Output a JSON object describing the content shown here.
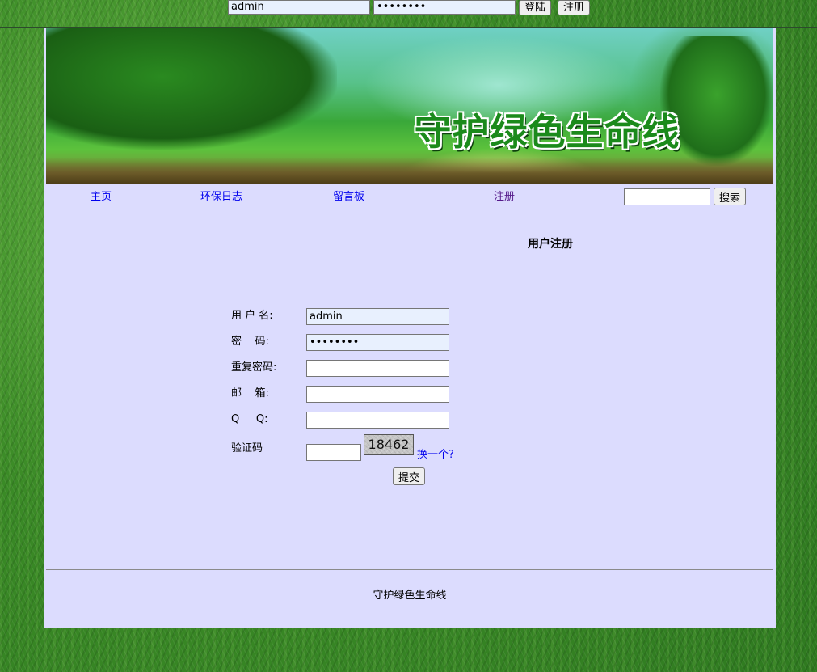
{
  "topbar": {
    "username_value": "admin",
    "password_value": "••••••••",
    "login_label": "登陆",
    "register_label": "注册"
  },
  "banner": {
    "title": "守护绿色生命线"
  },
  "nav": {
    "items": [
      {
        "label": "主页"
      },
      {
        "label": "环保日志"
      },
      {
        "label": "留言板"
      },
      {
        "label": "注册"
      }
    ],
    "search_label": "搜索",
    "search_value": ""
  },
  "page": {
    "title": "用户注册"
  },
  "form": {
    "username_label": "用 户 名:",
    "username_value": "admin",
    "password_label": "密    码:",
    "password_value": "••••••••",
    "confirm_label": "重复密码:",
    "email_label": "邮    箱:",
    "qq_label": "Q     Q:",
    "captcha_label": "验证码",
    "captcha_code": "18462",
    "captcha_refresh": "换一个?",
    "submit_label": "提交"
  },
  "footer": {
    "text": "守护绿色生命线"
  },
  "colors": {
    "panel": "#dcdcfe",
    "link": "#0000ee",
    "visited": "#551a8b",
    "autofill": "#e8f0fe"
  }
}
